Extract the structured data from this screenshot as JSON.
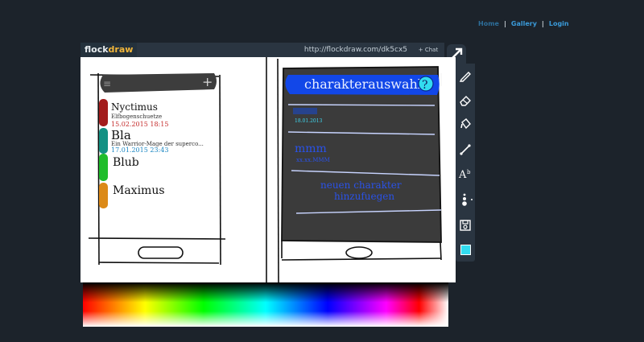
{
  "nav": {
    "home": "Home",
    "gallery": "Gallery",
    "login": "Login",
    "separator": "|"
  },
  "app": {
    "logo_a": "flock",
    "logo_b": "draw",
    "url": "http://flockdraw.com/dk5cx5",
    "chat": "+ Chat"
  },
  "left_phone": {
    "items": [
      {
        "name": "Nyctimus",
        "subtitle": "Elfbogenschuetze",
        "date": "15.02.2015   18:15",
        "color": "#a31c1c"
      },
      {
        "name": "Bla",
        "subtitle": "Ein Warrior-Mage der superco...",
        "date": "17.01.2015   23:43",
        "color": "#139183"
      },
      {
        "name": "Blub",
        "color": "#1fbd2b"
      },
      {
        "name": "Maximus",
        "color": "#dc8a18"
      }
    ]
  },
  "right_phone": {
    "header": "charakterauswahl",
    "help": "?",
    "entry1_date": "18.01.2013",
    "entry2_title": "mmm",
    "entry2_sub": "xx.xx.MMM",
    "new_char": [
      "neuen charakter",
      "hinzufuegen"
    ]
  },
  "tools": [
    "pencil-icon",
    "eraser-icon",
    "fill-bucket-icon",
    "line-icon",
    "text-icon",
    "brush-size-icon",
    "save-icon",
    "color-swatch"
  ],
  "colors": {
    "current_color": "#32dcf0",
    "accent": "#3a9ad9"
  }
}
